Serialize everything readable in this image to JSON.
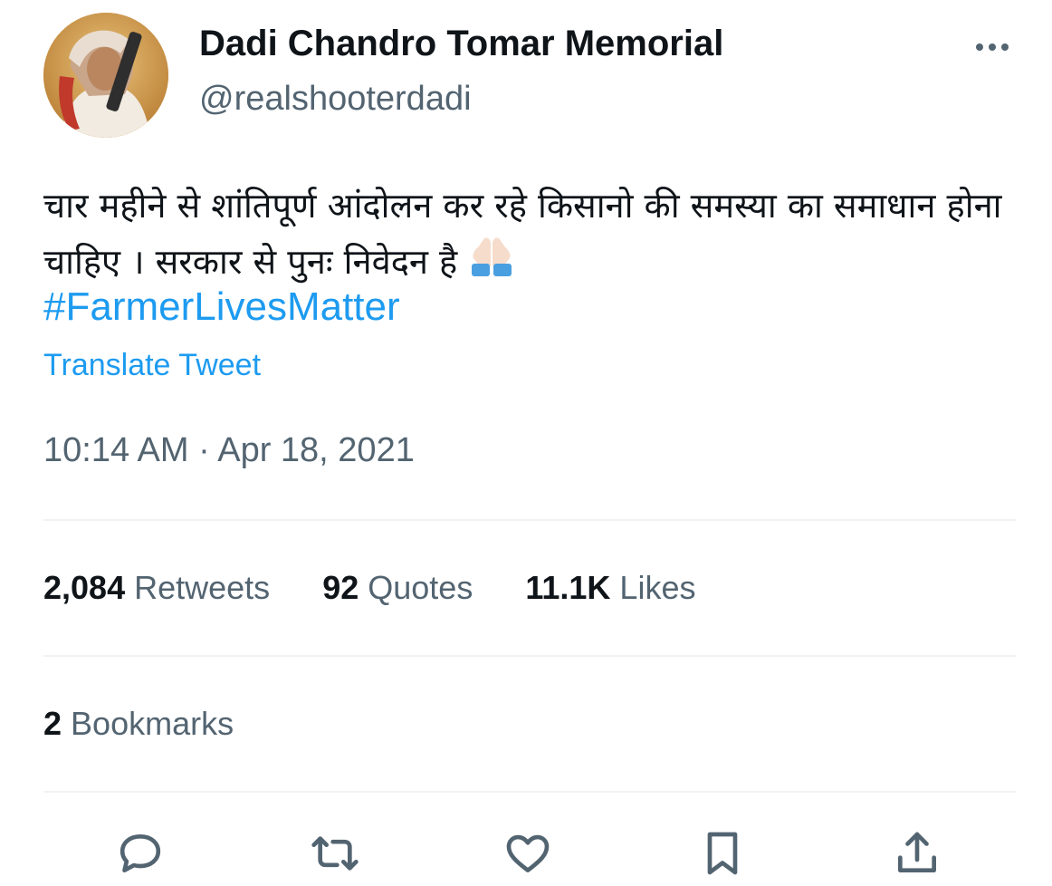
{
  "author": {
    "display_name": "Dadi Chandro Tomar Memorial",
    "handle": "@realshooterdadi",
    "avatar_icon": "profile-photo"
  },
  "tweet": {
    "text": "चार महीने से शांतिपूर्ण आंदोलन कर रहे किसानो की समस्या का समाधान होना चाहिए । सरकार से पुनः निवेदन है",
    "emoji": "folded-hands",
    "hashtag": "#FarmerLivesMatter",
    "translate_label": "Translate Tweet",
    "timestamp": "10:14 AM · Apr 18, 2021"
  },
  "stats": {
    "retweets_count": "2,084",
    "retweets_label": "Retweets",
    "quotes_count": "92",
    "quotes_label": "Quotes",
    "likes_count": "11.1K",
    "likes_label": "Likes",
    "bookmarks_count": "2",
    "bookmarks_label": "Bookmarks"
  },
  "actions": [
    {
      "icon": "reply-icon"
    },
    {
      "icon": "retweet-icon"
    },
    {
      "icon": "like-icon"
    },
    {
      "icon": "bookmark-icon"
    },
    {
      "icon": "share-icon"
    }
  ],
  "colors": {
    "link": "#1d9bf0",
    "secondary_text": "#536471",
    "primary_text": "#0f1419",
    "divider": "#eff3f4"
  }
}
